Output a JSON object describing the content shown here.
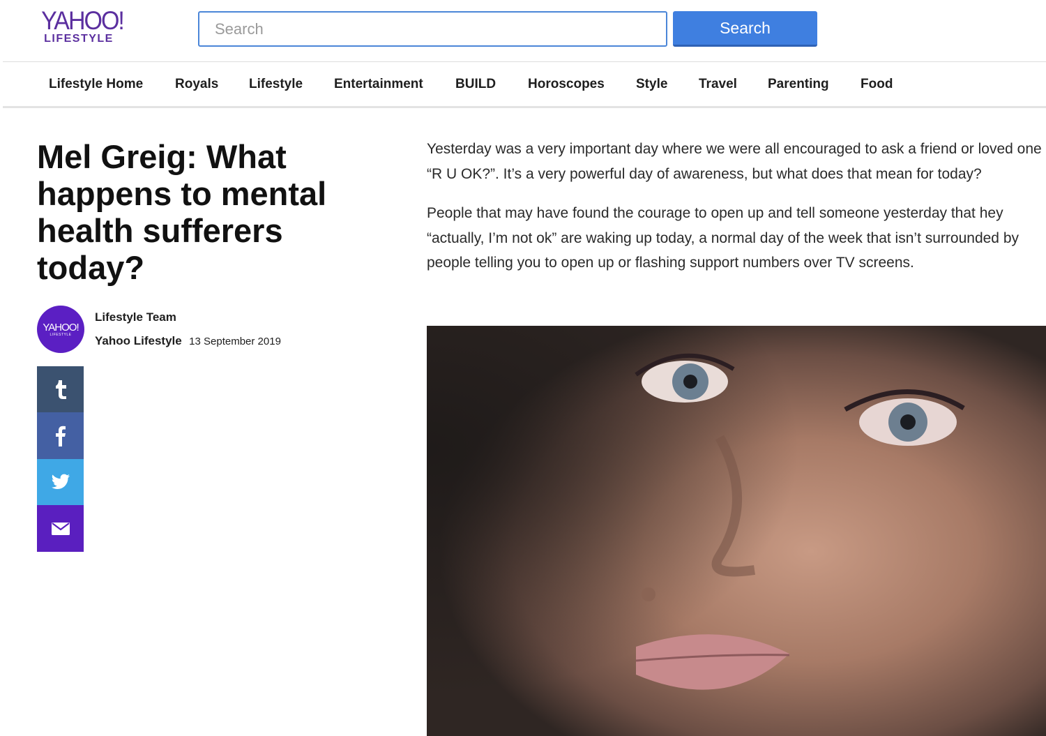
{
  "header": {
    "logo": {
      "main": "YAHOO!",
      "sub": "LIFESTYLE"
    },
    "search": {
      "placeholder": "Search",
      "button_label": "Search"
    }
  },
  "nav": {
    "items": [
      {
        "label": "Lifestyle Home"
      },
      {
        "label": "Royals"
      },
      {
        "label": "Lifestyle"
      },
      {
        "label": "Entertainment"
      },
      {
        "label": "BUILD"
      },
      {
        "label": "Horoscopes"
      },
      {
        "label": "Style"
      },
      {
        "label": "Travel"
      },
      {
        "label": "Parenting"
      },
      {
        "label": "Food"
      }
    ]
  },
  "article": {
    "headline": "Mel Greig: What happens to mental health sufferers today?",
    "author": "Lifestyle Team",
    "publisher": "Yahoo Lifestyle",
    "date": "13 September 2019",
    "avatar": {
      "main": "YAHOO!",
      "sub": "LIFESTYLE"
    },
    "paragraphs": [
      "Yesterday was a very important day where we were all encouraged to ask a friend or loved one “R U OK?”. It’s a very powerful day of awareness, but what does that mean for today?",
      "People that may have found the courage to open up and tell someone yesterday that hey “actually, I’m not ok” are waking up today, a normal day of the week that isn’t surrounded by people telling you to open up or flashing support numbers over TV screens."
    ]
  },
  "share": {
    "buttons": [
      {
        "icon": "tumblr-icon",
        "color": "#3b5270"
      },
      {
        "icon": "facebook-icon",
        "color": "#4460a3"
      },
      {
        "icon": "twitter-icon",
        "color": "#3fa8e6"
      },
      {
        "icon": "mail-icon",
        "color": "#5a1fbf"
      }
    ]
  },
  "colors": {
    "brand_purple": "#5b2f9f",
    "search_blue": "#3f7fe0"
  }
}
